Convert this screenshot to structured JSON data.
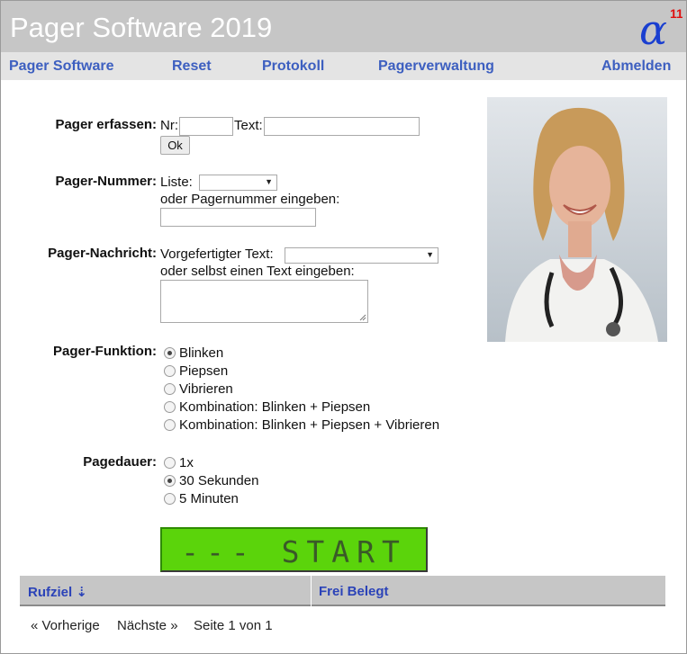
{
  "header": {
    "title": "Pager Software 2019",
    "logo_sup": "11"
  },
  "nav": [
    {
      "label": "Pager Software"
    },
    {
      "label": "Reset"
    },
    {
      "label": "Protokoll"
    },
    {
      "label": "Pagerverwaltung"
    },
    {
      "label": "Abmelden"
    }
  ],
  "form": {
    "erfassen": {
      "label": "Pager erfassen:",
      "nr_label": "Nr:",
      "text_label": "Text:",
      "nr_value": "",
      "text_value": "",
      "ok": "Ok"
    },
    "nummer": {
      "label": "Pager-Nummer:",
      "liste_label": "Liste:",
      "liste_value": "",
      "hint": "oder Pagernummer eingeben:",
      "value": ""
    },
    "nachricht": {
      "label": "Pager-Nachricht:",
      "vorgefertigt_label": "Vorgefertigter Text:",
      "vorgefertigt_value": "",
      "hint": "oder selbst einen Text eingeben:",
      "value": ""
    },
    "funktion": {
      "label": "Pager-Funktion:",
      "options": [
        "Blinken",
        "Piepsen",
        "Vibrieren",
        "Kombination: Blinken + Piepsen",
        "Kombination: Blinken + Piepsen + Vibrieren"
      ],
      "selected": "Blinken"
    },
    "dauer": {
      "label": "Pagedauer:",
      "options": [
        "1x",
        "30 Sekunden",
        "5 Minuten"
      ],
      "selected": "30 Sekunden"
    },
    "start": "---  START  ---"
  },
  "table": {
    "columns": [
      "Rufziel ⇣",
      "Frei Belegt"
    ]
  },
  "pagination": {
    "prev": "« Vorherige",
    "next": "Nächste »",
    "info": "Seite 1 von 1"
  },
  "colors": {
    "header_bg": "#c6c6c6",
    "nav_bg": "#e4e4e4",
    "link": "#3d5fc0",
    "start_green": "#5bd40b"
  }
}
